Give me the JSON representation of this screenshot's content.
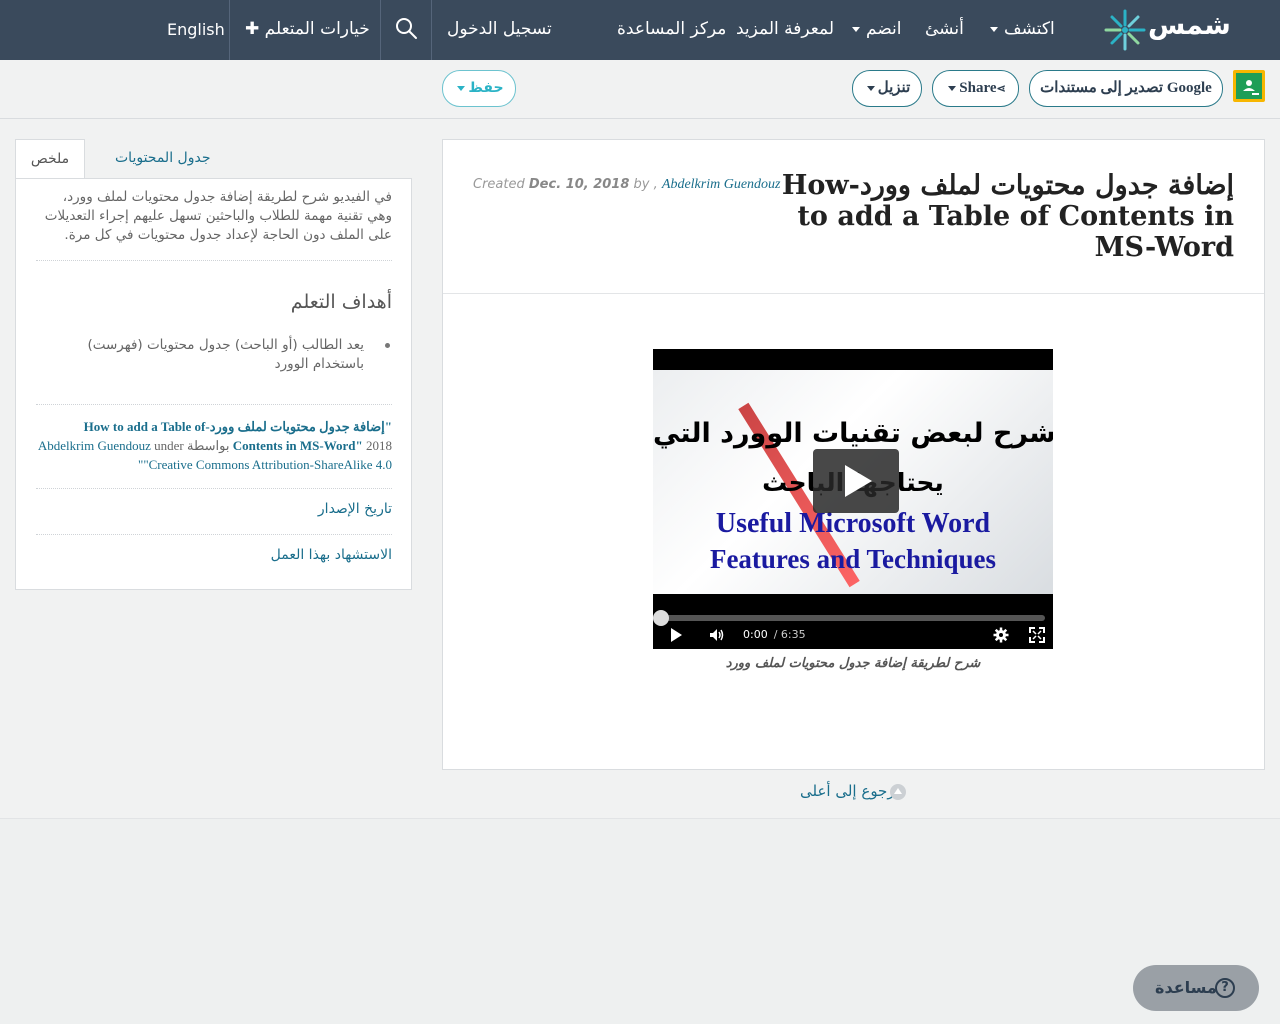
{
  "nav": {
    "logo_text": "شمس",
    "explore": "اكتشف",
    "create": "أنشئ",
    "join": "انضم",
    "learn_more": "لمعرفة المزيد",
    "help_center": "مركز المساعدة",
    "login": "تسجيل الدخول",
    "learner_options": "خيارات المتعلم",
    "language": "English",
    "icons": [
      "search-icon",
      "plus-icon",
      "chevron-down-icon"
    ]
  },
  "toolbar": {
    "export_google": "تصدير إلى مستندات Google",
    "share": "Share",
    "download": "تنزيل",
    "save": "حفظ"
  },
  "document": {
    "title": "إضافة جدول محتويات لملف وورد-How to add a Table of Contents in MS-Word",
    "created_label": "Created",
    "created_date": "Dec. 10, 2018",
    "by_label": "by ,",
    "author": "Abdelkrim Guendouz"
  },
  "video": {
    "text_line1": "شرح لبعض تقنيات الوورد التي",
    "text_line2": "يحتاجها الباحث",
    "text_line3": "Useful Microsoft Word",
    "text_line4": "Features and Techniques",
    "current_time": "0:00",
    "duration": "/ 6:35",
    "progress": 0,
    "caption": "شرح لطريقة إضافة جدول محتويات لملف وورد"
  },
  "back_to_top": "رجوع إلى أعلى",
  "sidebar": {
    "tab_summary": "ملخص",
    "tab_toc": "جدول المحتويات",
    "summary": "في الفيديو شرح لطريقة إضافة جدول محتويات لملف وورد، وهي تقنية مهمة للطلاب والباحثين تسهل عليهم إجراء التعديلات على الملف دون الحاجة لإعداد جدول محتويات في كل مرة.",
    "objectives_heading": "أهداف التعلم",
    "objective_1": "يعد الطالب (أو الباحث) جدول محتويات (فهرست) باستخدام الوورد",
    "attr_title": "\"إضافة جدول محتويات لملف وورد-How to add a Table of Contents in MS-Word\"",
    "attr_year": "2018",
    "attr_by": "بواسطة",
    "attr_author": "Abdelkrim Guendouz",
    "attr_under": "under",
    "attr_license": "\"Creative Commons Attribution-ShareAlike 4.0\"",
    "version_history": "تاريخ الإصدار",
    "cite_work": "الاستشهاد بهذا العمل"
  },
  "help_button": "مساعدة",
  "colors": {
    "nav_bg": "#3a4a5c",
    "link": "#1a6e8c",
    "accent": "#2bb3c6"
  }
}
